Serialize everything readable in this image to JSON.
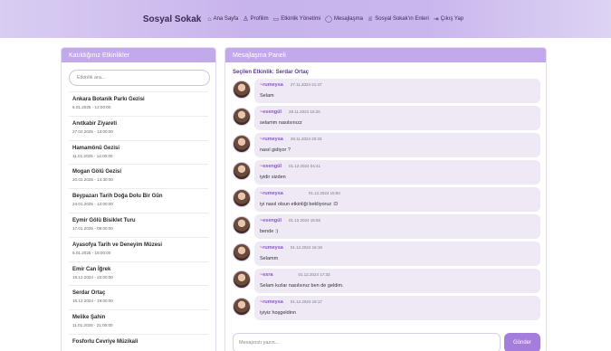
{
  "header": {
    "brand": "Sosyal Sokak",
    "nav": [
      {
        "icon": "home-icon",
        "glyph": "⌂",
        "label": "Ana Sayfa"
      },
      {
        "icon": "user-icon",
        "glyph": "♙",
        "label": "Profilim"
      },
      {
        "icon": "calendar-icon",
        "glyph": "▭",
        "label": "Etkinlik Yönetimi"
      },
      {
        "icon": "chat-icon",
        "glyph": "◯",
        "label": "Mesajlaşma"
      },
      {
        "icon": "trophy-icon",
        "glyph": "♕",
        "label": "Sosyal Sokak'ın Enleri"
      },
      {
        "icon": "logout-icon",
        "glyph": "⇥",
        "label": "Çıkış Yap"
      }
    ]
  },
  "left_panel": {
    "title": "Katıldığınız Etkinlikler",
    "search_placeholder": "Etkinlik ara...",
    "events": [
      {
        "title": "Ankara Botanik Parkı Gezisi",
        "date": "6.01.2025 - 12:00:00"
      },
      {
        "title": "Anıtkabir Ziyareti",
        "date": "27.02.2025 - 13:00:00"
      },
      {
        "title": "Hamamönü Gezisi",
        "date": "11.01.2025 - 14:00:00"
      },
      {
        "title": "Mogan Gölü Gezisi",
        "date": "20.02.2025 - 14:30:00"
      },
      {
        "title": "Beypazarı Tarih Doğa Dolu Bir Gün",
        "date": "24.01.2025 - 12:00:00"
      },
      {
        "title": "Eymir Gölü Bisiklet Turu",
        "date": "17.01.2025 - 09:00:00"
      },
      {
        "title": "Ayasofya Tarih ve Deneyim Müzesi",
        "date": "5.01.2025 - 18:00:00"
      },
      {
        "title": "Emir Can İğrek",
        "date": "18.12.2024 - 22:00:00"
      },
      {
        "title": "Serdar Ortaç",
        "date": "18.12.2024 - 19:00:00"
      },
      {
        "title": "Melike Şahin",
        "date": "11.01.2025 - 21:00:00"
      },
      {
        "title": "Fosforlu Cevriye Müzikali",
        "date": ""
      }
    ]
  },
  "right_panel": {
    "title": "Mesajlaşma Paneli",
    "selected_event": "Seçilen Etkinlik: Serdar Ortaç",
    "messages": [
      {
        "user": "~rumeysa",
        "time": "27.11.2024 21:47",
        "text": "Selam"
      },
      {
        "user": "~esengül",
        "time": "29.11.2024 15:26",
        "text": "selamm nasılsınızz"
      },
      {
        "user": "~rumeysa",
        "time": "29.11.2024 20:33",
        "text": "nasıl gidiyor ?"
      },
      {
        "user": "~esengül",
        "time": "01.12.2024 04:41",
        "text": "iyidir sizden"
      },
      {
        "user": "~rumeysa",
        "time": "01.12.2024 15:50",
        "text": "iyi nasıl olsun etkinliği bekliyoruz :D"
      },
      {
        "user": "~esengül",
        "time": "01.12.2024 15:55",
        "text": "bende :)"
      },
      {
        "user": "~rumeysa",
        "time": "01.12.2024 16:19",
        "text": "Selamm"
      },
      {
        "user": "~esra",
        "time": "01.12.2024 17:33",
        "text": "Selam kızlar nasılsınız ben de geldim."
      },
      {
        "user": "~rumeysa",
        "time": "01.12.2024 18:17",
        "text": "iyiyiz hoşgeldinn"
      }
    ],
    "input_placeholder": "Mesajınızı yazın...",
    "send_label": "Gönder"
  }
}
